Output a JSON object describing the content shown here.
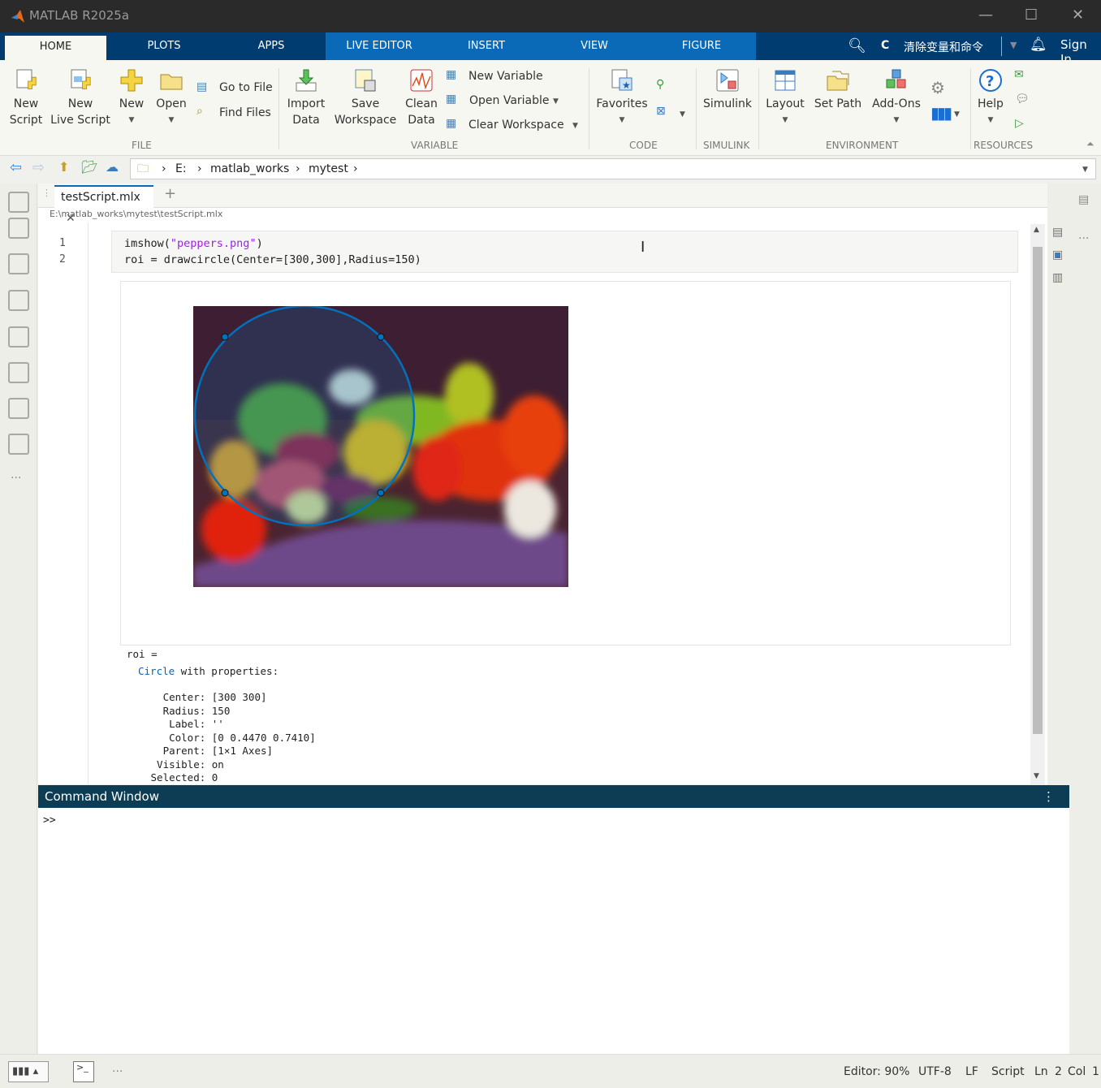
{
  "window": {
    "title": "MATLAB R2025a",
    "minimize": "—",
    "maximize": "☐",
    "close": "✕"
  },
  "tabs": [
    {
      "label": "HOME"
    },
    {
      "label": "PLOTS"
    },
    {
      "label": "APPS"
    },
    {
      "label": "LIVE EDITOR"
    },
    {
      "label": "INSERT"
    },
    {
      "label": "VIEW"
    },
    {
      "label": "FIGURE"
    }
  ],
  "topbar": {
    "shortcut_label": "清除变量和命令",
    "signin": "Sign In"
  },
  "ribbon": {
    "file": {
      "group": "FILE",
      "new_script": [
        "New",
        "Script"
      ],
      "new_live_script": [
        "New",
        "Live Script"
      ],
      "new": "New",
      "open": "Open",
      "go_to_file": "Go to File",
      "find_files": "Find Files"
    },
    "variable": {
      "group": "VARIABLE",
      "import_data": [
        "Import",
        "Data"
      ],
      "save_workspace": [
        "Save",
        "Workspace"
      ],
      "clean_data": [
        "Clean",
        "Data"
      ],
      "new_variable": "New Variable",
      "open_variable": "Open Variable",
      "clear_workspace": "Clear Workspace"
    },
    "code": {
      "group": "CODE",
      "favorites": "Favorites"
    },
    "simulink": {
      "group": "SIMULINK",
      "simulink": "Simulink"
    },
    "environment": {
      "group": "ENVIRONMENT",
      "layout": "Layout",
      "set_path": "Set Path",
      "add_ons": "Add-Ons"
    },
    "resources": {
      "group": "RESOURCES",
      "help": "Help"
    }
  },
  "address": {
    "crumbs": [
      "E:",
      "matlab_works",
      "mytest"
    ]
  },
  "editor": {
    "tab": "testScript.mlx",
    "close": "✕",
    "add": "+",
    "path": "E:\\matlab_works\\mytest\\testScript.mlx",
    "lines": [
      {
        "n": "1",
        "pre": "imshow(",
        "str": "\"peppers.png\"",
        "post": ")"
      },
      {
        "n": "2",
        "pre": "roi = drawcircle(Center=[300,300],Radius=150)",
        "str": "",
        "post": ""
      }
    ],
    "output": {
      "var": "roi =",
      "class": "Circle",
      "with": " with properties:",
      "props": [
        "   Center: [300 300]",
        "   Radius: 150",
        "    Label: ''",
        "    Color: [0 0.4470 0.7410]",
        "   Parent: [1×1 Axes]",
        "  Visible: on",
        " Selected: 0"
      ]
    },
    "roi_color": "#0072bd"
  },
  "command_window": {
    "title": "Command Window",
    "prompt": ">>"
  },
  "status": {
    "zoom": "Editor: 90%",
    "encoding": "UTF-8",
    "eol": "LF",
    "type": "Script",
    "ln": "Ln",
    "ln_val": "2",
    "col": "Col",
    "col_val": "1"
  }
}
